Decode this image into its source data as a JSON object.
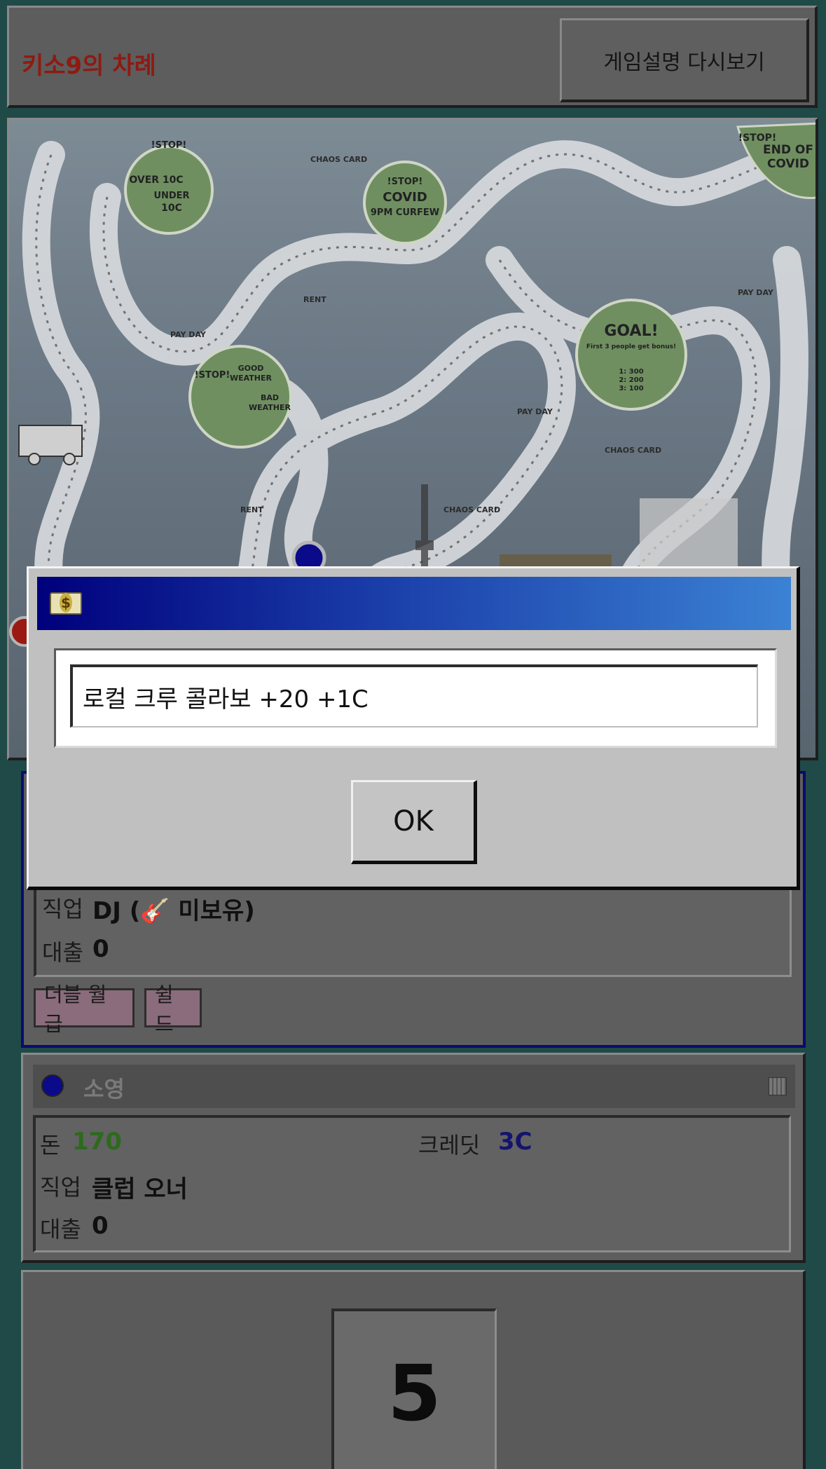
{
  "header": {
    "turn_label": "키소9의 차례",
    "rules_button": "게임설명 다시보기"
  },
  "board": {
    "stop_covid": [
      "!STOP!",
      "COVID",
      "9PM CURFEW"
    ],
    "stop_over": [
      "!STOP!",
      "OVER 10C",
      "UNDER",
      "10C"
    ],
    "stop_weather": [
      "!STOP!",
      "GOOD",
      "WEATHER",
      "BAD",
      "WEATHER"
    ],
    "goal": [
      "GOAL!",
      "First 3 people get bonus!",
      "1: 300",
      "2: 200",
      "3: 100"
    ],
    "end_of_covid": [
      "!STOP!",
      "END OF",
      "COVID"
    ],
    "spaces": [
      "PAY DAY",
      "CHAOS CARD",
      "RENT",
      "PAY DAY",
      "CHAOS CARD",
      "RENT",
      "PAY DAY",
      "CHAOS CARD"
    ]
  },
  "current_player": {
    "job_label": "직업",
    "job_value": "DJ (🎸 미보유)",
    "loan_label": "대출",
    "loan_value": "0",
    "cards": [
      "더블 월급",
      "쉴드"
    ]
  },
  "other_player": {
    "name": "소영",
    "money_label": "돈",
    "money_value": "170",
    "credit_label": "크레딧",
    "credit_value": "3C",
    "job_label": "직업",
    "job_value": "클럽 오너",
    "loan_label": "대출",
    "loan_value": "0"
  },
  "dice": {
    "value": "5"
  },
  "dialog": {
    "icon": "money-icon",
    "icon_glyph": "$",
    "message": "로컬 크루 콜라보 +20 +1C",
    "ok_label": "OK"
  },
  "colors": {
    "turn_label": "#8e1a12",
    "money_value": "#2e6a1e",
    "credit_value": "#14146e",
    "player_color": "#0a0a8a",
    "dialog_title_start": "#00007c",
    "dialog_title_end": "#3b82d4"
  }
}
